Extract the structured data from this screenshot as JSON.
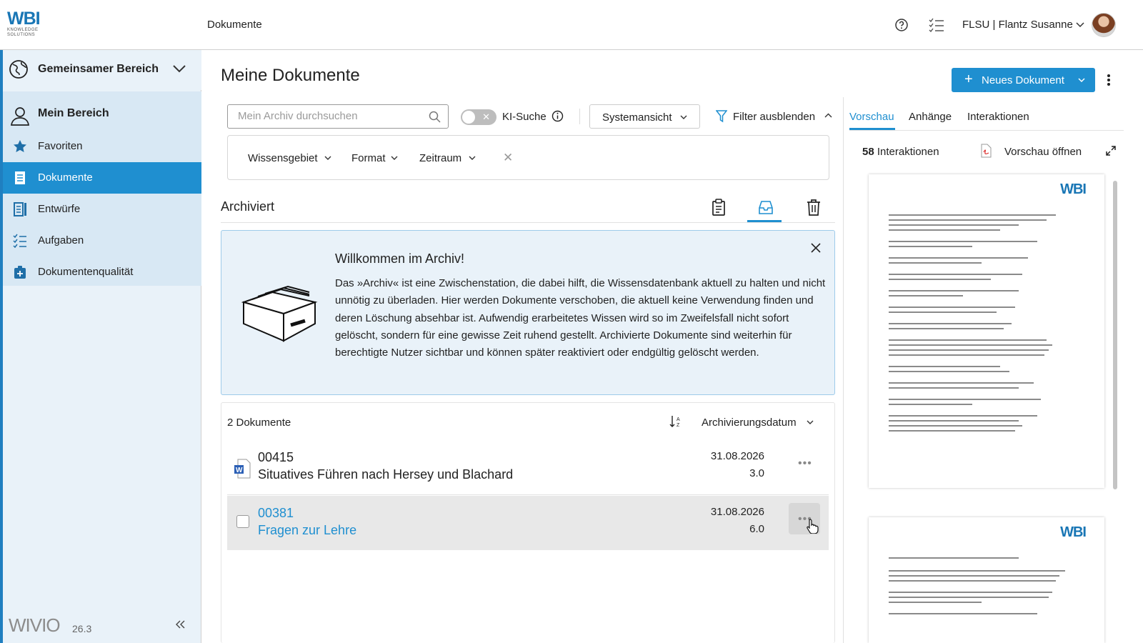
{
  "header": {
    "logo_text": "WBI",
    "logo_sub": "KNOWLEDGE SOLUTIONS",
    "section_title": "Dokumente",
    "user_label": "FLSU | Flantz Susanne"
  },
  "sidebar": {
    "area_label": "Gemeinsamer Bereich",
    "items": [
      {
        "label": "Mein Bereich",
        "icon": "user-icon"
      },
      {
        "label": "Favoriten",
        "icon": "star-icon"
      },
      {
        "label": "Dokumente",
        "icon": "document-icon"
      },
      {
        "label": "Entwürfe",
        "icon": "drafts-icon"
      },
      {
        "label": "Aufgaben",
        "icon": "tasks-icon"
      },
      {
        "label": "Dokumentenqualität",
        "icon": "quality-icon"
      }
    ],
    "brand": "WIVIO",
    "version": "26.3"
  },
  "main": {
    "title": "Meine Dokumente",
    "new_button": "Neues Dokument",
    "search_placeholder": "Mein Archiv durchsuchen",
    "ki_label": "KI-Suche",
    "view_select": "Systemansicht",
    "filter_toggle": "Filter ausblenden",
    "filters": [
      "Wissensgebiet",
      "Format",
      "Zeitraum"
    ],
    "archive_title": "Archiviert",
    "info": {
      "title": "Willkommen im Archiv!",
      "text": "Das »Archiv« ist eine Zwischenstation, die dabei hilft, die Wissensdatenbank aktuell zu halten und nicht unnötig zu überladen. Hier werden Dokumente verschoben, die aktuell keine Verwendung finden und deren Löschung absehbar ist. Aufwendig erarbeitetes Wissen wird so im Zweifelsfall nicht sofort gelöscht, sondern für eine gewisse Zeit ruhend gestellt. Archivierte Dokumente sind weiterhin für berechtigte Nutzer sichtbar und können später reaktiviert oder endgültig gelöscht werden."
    },
    "doc_count": "2 Dokumente",
    "sort_label": "Archivierungsdatum",
    "documents": [
      {
        "id": "00415",
        "name": "Situatives Führen nach Hersey und Blachard",
        "date": "31.08.2026",
        "version": "3.0"
      },
      {
        "id": "00381",
        "name": "Fragen zur Lehre",
        "date": "31.08.2026",
        "version": "6.0"
      }
    ]
  },
  "preview": {
    "tabs": [
      "Vorschau",
      "Anhänge",
      "Interaktionen"
    ],
    "interactions_count": "58",
    "interactions_label": "Interaktionen",
    "open_preview": "Vorschau öffnen",
    "page_logo": "WBI"
  },
  "colors": {
    "accent": "#1f8fd0",
    "sidebar_bg": "#e9f2f9",
    "info_bg": "#e9f2f9"
  }
}
